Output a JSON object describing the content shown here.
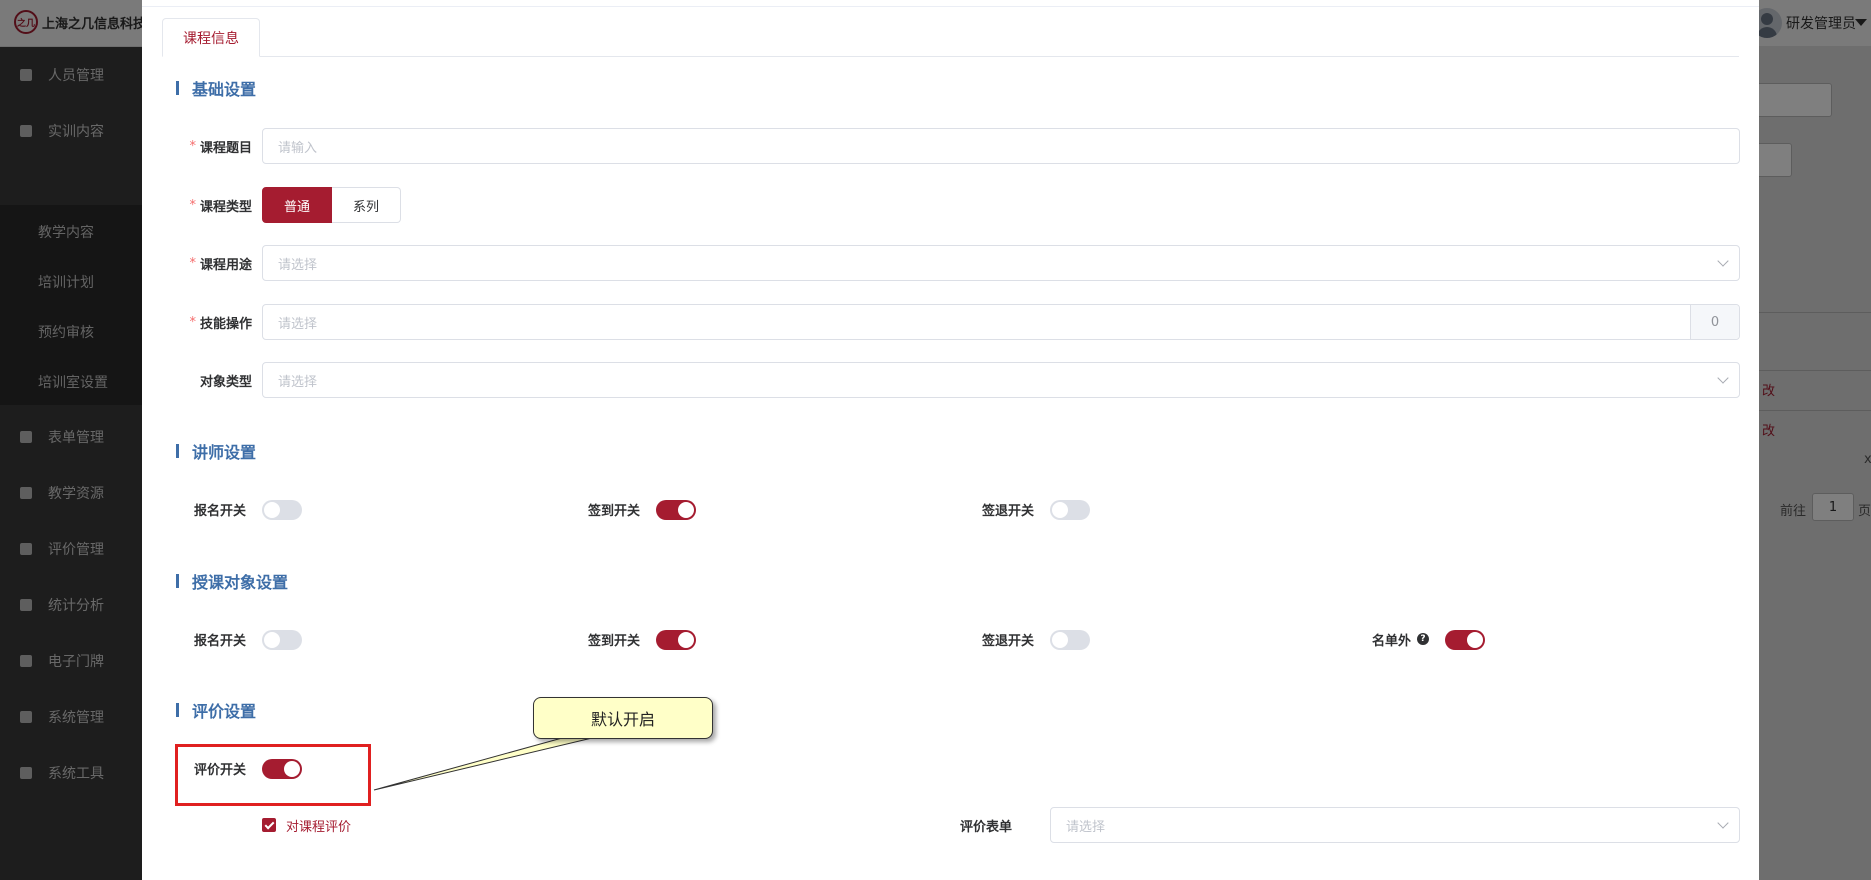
{
  "app": {
    "logo_text": "之几",
    "company": "上海之几信息科技",
    "user": "研发管理员"
  },
  "sidebar": {
    "items": [
      {
        "label": "人员管理",
        "icon": "users-icon"
      },
      {
        "label": "实训内容",
        "icon": "tree-icon"
      },
      {
        "label": "表单管理",
        "icon": "form-icon"
      },
      {
        "label": "教学资源",
        "icon": "book-icon"
      },
      {
        "label": "评价管理",
        "icon": "evaluate-icon"
      },
      {
        "label": "统计分析",
        "icon": "bar-chart-icon"
      },
      {
        "label": "电子门牌",
        "icon": "monitor-icon"
      },
      {
        "label": "系统管理",
        "icon": "gear-icon"
      },
      {
        "label": "系统工具",
        "icon": "toolbox-icon"
      }
    ],
    "sub_items": [
      "教学内容",
      "培训计划",
      "预约审核",
      "培训室设置"
    ]
  },
  "background": {
    "action_label_1": "改",
    "action_label_2": "改",
    "close_glyph": "x",
    "pager_prefix": "前往",
    "pager_value": "1",
    "pager_suffix": "页"
  },
  "dialog": {
    "tab": "课程信息",
    "sections": {
      "basic": "基础设置",
      "lecturer": "讲师设置",
      "audience": "授课对象设置",
      "evaluation": "评价设置"
    },
    "basic": {
      "title_label": "课程题目",
      "title_placeholder": "请输入",
      "type_label": "课程类型",
      "type_options": [
        "普通",
        "系列"
      ],
      "type_selected": "普通",
      "usage_label": "课程用途",
      "usage_placeholder": "请选择",
      "skill_label": "技能操作",
      "skill_placeholder": "请选择",
      "skill_count": "0",
      "object_label": "对象类型",
      "object_placeholder": "请选择"
    },
    "lecturer": {
      "signup_label": "报名开关",
      "signup_on": false,
      "checkin_label": "签到开关",
      "checkin_on": true,
      "checkout_label": "签退开关",
      "checkout_on": false
    },
    "audience": {
      "signup_label": "报名开关",
      "signup_on": false,
      "checkin_label": "签到开关",
      "checkin_on": true,
      "checkout_label": "签退开关",
      "checkout_on": false,
      "whitelist_label": "名单外",
      "whitelist_help": "?",
      "whitelist_on": true
    },
    "evaluation": {
      "switch_label": "评价开关",
      "switch_on": true,
      "course_eval_label": "对课程评价",
      "course_eval_checked": true,
      "form_label": "评价表单",
      "form_placeholder": "请选择"
    }
  },
  "annotation": {
    "callout": "默认开启"
  },
  "colors": {
    "primary": "#a51c30",
    "section": "#3e6ea8",
    "callout_bg": "#ffffc8",
    "highlight": "#e02020"
  }
}
